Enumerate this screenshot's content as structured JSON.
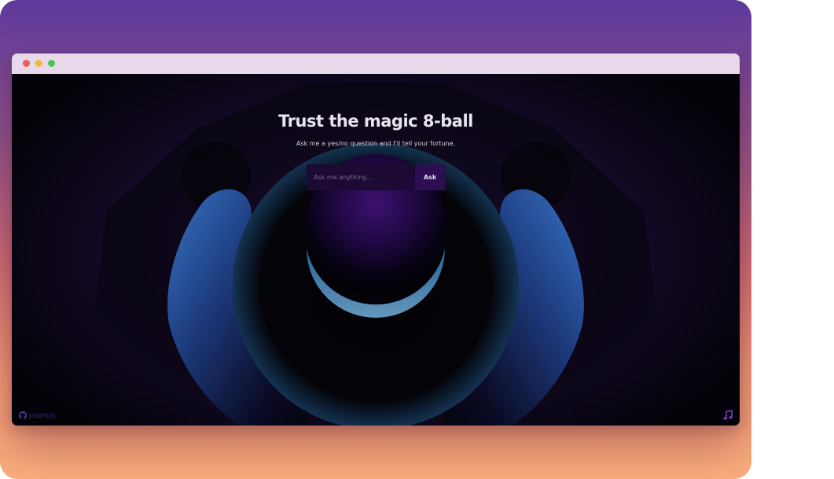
{
  "window": {
    "controls": [
      "close",
      "minimize",
      "maximize"
    ]
  },
  "page": {
    "title": "Trust the magic 8-ball",
    "subtitle": "Ask me a yes/no question and I'll tell your fortune.",
    "input_placeholder": "Ask me anything...",
    "ask_label": "Ask"
  },
  "footer": {
    "github_label": "jcbdhjzn",
    "github_icon": "github-icon",
    "music_icon": "music-note-icon"
  },
  "colors": {
    "accent": "#2b0f52",
    "ball_glow": "#3c1170",
    "hand_glow": "#3b7fd6",
    "link": "#3a2a8a"
  }
}
